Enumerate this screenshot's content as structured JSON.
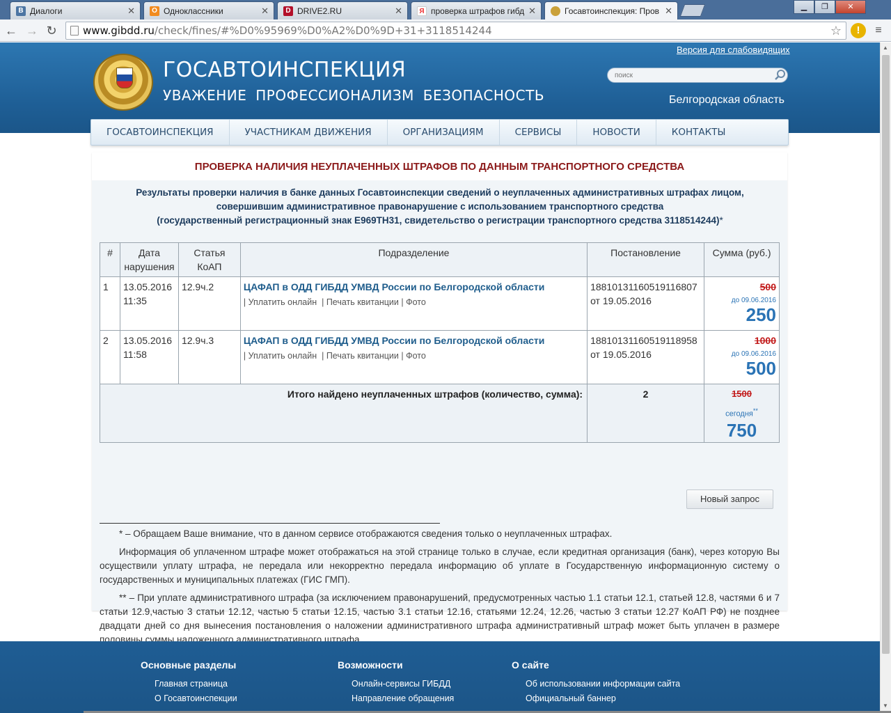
{
  "browser": {
    "tabs": [
      {
        "label": "Диалоги",
        "icon": "vk-icon",
        "color": "#4c75a3"
      },
      {
        "label": "Одноклассники",
        "icon": "odnoklassniki-icon",
        "color": "#f28b1f"
      },
      {
        "label": "DRIVE2.RU",
        "icon": "drive2-icon",
        "color": "#b3102a"
      },
      {
        "label": "проверка штрафов гибд",
        "icon": "yandex-icon",
        "color": "#e33"
      },
      {
        "label": "Госавтоинспекция: Пров",
        "icon": "gibdd-icon",
        "color": "#caa13a"
      }
    ],
    "url_host": "www.gibdd.ru",
    "url_path": "/check/fines/#%D0%95969%D0%A2%D0%9D+31+3118514244"
  },
  "header": {
    "title": "ГОСАВТОИНСПЕКЦИЯ",
    "motto": "УВАЖЕНИЕ  ПРОФЕССИОНАЛИЗМ  БЕЗОПАСНОСТЬ",
    "accessibility_link": "Версия для слабовидящих",
    "search_placeholder": "поиск",
    "region": "Белгородская область"
  },
  "nav": [
    "ГОСАВТОИНСПЕКЦИЯ",
    "УЧАСТНИКАМ ДВИЖЕНИЯ",
    "ОРГАНИЗАЦИЯМ",
    "СЕРВИСЫ",
    "НОВОСТИ",
    "КОНТАКТЫ"
  ],
  "main": {
    "heading": "ПРОВЕРКА НАЛИЧИЯ НЕУПЛАЧЕННЫХ ШТРАФОВ ПО ДАННЫМ ТРАНСПОРТНОГО СРЕДСТВА",
    "intro_line1": "Результаты проверки наличия в банке данных Госавтоинспекции сведений о неуплаченных административных штрафах лицом,",
    "intro_line2": "совершившим административное правонарушение с использованием транспортного средства",
    "intro_line3": "(государственный регистрационный знак Е969ТН31, свидетельство о регистрации транспортного средства 3118514244)",
    "intro_asterisk": "*",
    "table": {
      "headers": [
        "#",
        "Дата нарушения",
        "Статья КоАП",
        "Подразделение",
        "Постановление",
        "Сумма (руб.)"
      ],
      "rows": [
        {
          "n": "1",
          "date": "13.05.2016",
          "time": "11:35",
          "article": "12.9ч.2",
          "dept": "ЦАФАП в ОДД ГИБДД УМВД России по Белгородской области",
          "link_pay": "Уплатить онлайн",
          "link_print": "Печать квитанции",
          "link_photo": "Фото",
          "decree_no": "18810131160519116807",
          "decree_date": "от 19.05.2016",
          "old_sum": "500",
          "until": "до 09.06.2016",
          "new_sum": "250"
        },
        {
          "n": "2",
          "date": "13.05.2016",
          "time": "11:58",
          "article": "12.9ч.3",
          "dept": "ЦАФАП в ОДД ГИБДД УМВД России по Белгородской области",
          "link_pay": "Уплатить онлайн",
          "link_print": "Печать квитанции",
          "link_photo": "Фото",
          "decree_no": "18810131160519118958",
          "decree_date": "от 19.05.2016",
          "old_sum": "1000",
          "until": "до 09.06.2016",
          "new_sum": "500"
        }
      ],
      "total_label": "Итого найдено неуплаченных штрафов (количество, сумма):",
      "total_count": "2",
      "total_old": "1500",
      "total_today": "сегодня",
      "total_today_mark": "**",
      "total_new": "750"
    },
    "new_request_button": "Новый запрос",
    "notes": [
      "* – Обращаем Ваше внимание, что в данном сервисе отображаются сведения только о неуплаченных штрафах.",
      "Информация об уплаченном штрафе может отображаться на этой странице только в случае, если кредитная организация (банк), через которую Вы осуществили уплату штрафа, не передала или некорректно передала информацию об уплате в Государственную информационную систему о государственных и муниципальных платежах (ГИС ГМП).",
      "** – При уплате административного штрафа (за исключением правонарушений, предусмотренных частью 1.1 статьи 12.1, статьей 12.8, частями 6 и 7 статьи 12.9,частью 3 статьи 12.12, частью 5 статьи 12.15, частью 3.1 статьи 12.16, статьями 12.24, 12.26, частью 3 статьи 12.27 КоАП РФ) не позднее двадцати дней со дня вынесения постановления о наложении административного штрафа административный штраф может быть уплачен в размере половины суммы наложенного административного штрафа."
    ]
  },
  "footer": {
    "columns": [
      {
        "title": "Основные разделы",
        "links": [
          "Главная страница",
          "О Госавтоинспекции"
        ]
      },
      {
        "title": "Возможности",
        "links": [
          "Онлайн-сервисы ГИБДД",
          "Направление обращения"
        ]
      },
      {
        "title": "О сайте",
        "links": [
          "Об использовании информации сайта",
          "Официальный баннер"
        ]
      }
    ]
  }
}
